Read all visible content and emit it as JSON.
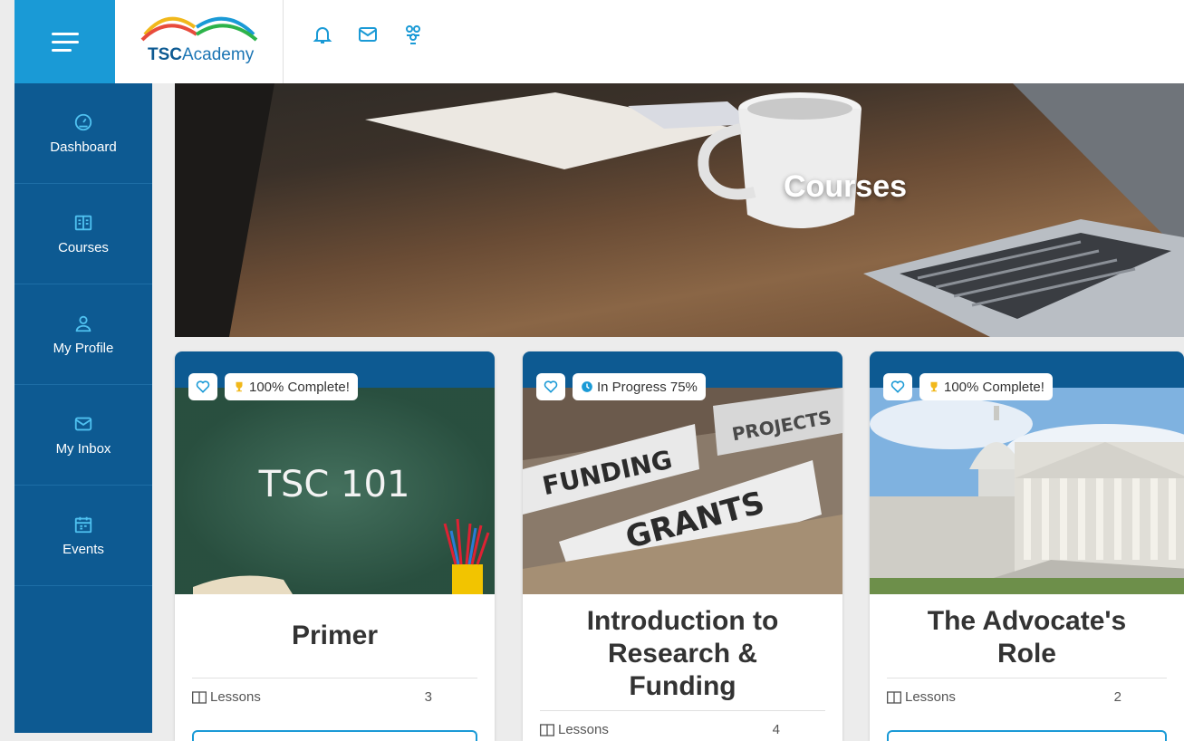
{
  "header": {
    "logo_strong": "TSC",
    "logo_light": "Academy",
    "icons": [
      "bell-icon",
      "mail-icon",
      "people-icon"
    ]
  },
  "sidebar": {
    "items": [
      {
        "label": "Dashboard",
        "icon": "dashboard-gauge-icon"
      },
      {
        "label": "Courses",
        "icon": "book-icon"
      },
      {
        "label": "My Profile",
        "icon": "user-icon"
      },
      {
        "label": "My Inbox",
        "icon": "mail-icon"
      },
      {
        "label": "Events",
        "icon": "calendar-icon"
      }
    ]
  },
  "hero": {
    "title": "Courses"
  },
  "courses": [
    {
      "status": "100% Complete!",
      "status_icon": "trophy-icon",
      "image_text": "TSC 101",
      "title": "Primer",
      "meta_label": "Lessons",
      "meta_count": "3"
    },
    {
      "status": "In Progress 75%",
      "status_icon": "clock-icon",
      "image_words": [
        "FUNDING",
        "PROJECTS",
        "GRANTS"
      ],
      "title": "Introduction to Research & Funding",
      "meta_label": "Lessons",
      "meta_count": "4"
    },
    {
      "status": "100% Complete!",
      "status_icon": "trophy-icon",
      "title": "The Advocate's Role",
      "meta_label": "Lessons",
      "meta_count": "2"
    }
  ],
  "colors": {
    "primary_dark": "#0d5a92",
    "accent": "#1a9ad6",
    "trophy": "#f1b81b"
  }
}
